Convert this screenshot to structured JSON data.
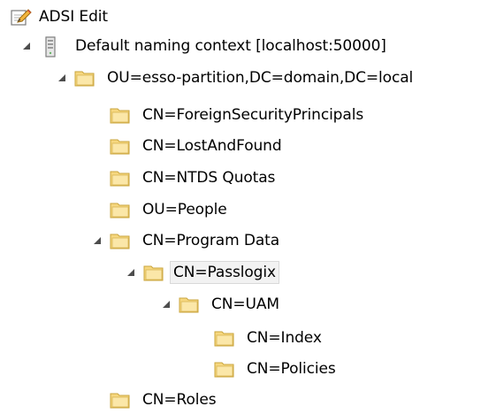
{
  "app": {
    "title": "ADSI Edit",
    "icon": "adsi-edit-icon"
  },
  "tree": {
    "root_connection": {
      "label": "Default naming context [localhost:50000]",
      "icon": "server-icon",
      "expanded": true
    },
    "partition": {
      "label": "OU=esso-partition,DC=domain,DC=local",
      "icon": "folder-icon",
      "expanded": true
    },
    "items": {
      "foreign_security_principals": "CN=ForeignSecurityPrincipals",
      "lost_and_found": "CN=LostAndFound",
      "ntds_quotas": "CN=NTDS Quotas",
      "people": "OU=People",
      "program_data": "CN=Program Data",
      "passlogix": "CN=Passlogix",
      "uam": "CN=UAM",
      "index": "CN=Index",
      "policies": "CN=Policies",
      "roles": "CN=Roles"
    },
    "selected_item": "CN=Passlogix"
  },
  "colors": {
    "folder_fill": "#f6d77f",
    "folder_edge": "#c9a43c",
    "expander": "#4d4d4d",
    "selection_bg": "#f2f2f2",
    "selection_border": "#d9d9d9"
  }
}
